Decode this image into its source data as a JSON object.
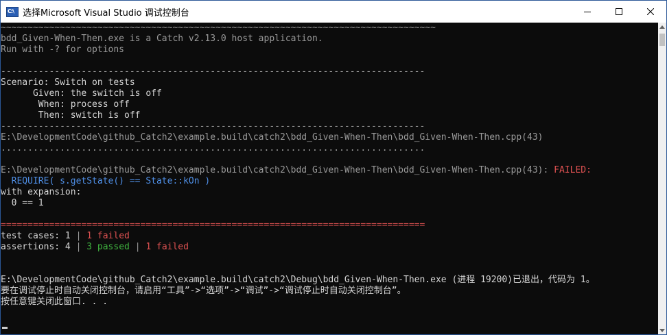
{
  "window": {
    "title": "选择Microsoft Visual Studio 调试控制台",
    "icon_label": "C:\\"
  },
  "console": {
    "lines": [
      {
        "segments": [
          {
            "text": "~~~~~~~~~~~~~~~~~~~~~~~~~~~~~~~~~~~~~~~~~~~~~~~~~~~~~~~~~~~~~~~~~~~~~~~~~~~~~~~~~",
            "style": "gray"
          }
        ]
      },
      {
        "segments": [
          {
            "text": "bdd_Given-When-Then.exe is a Catch v2.13.0 host application.",
            "style": "gray"
          }
        ]
      },
      {
        "segments": [
          {
            "text": "Run with -? for options",
            "style": "gray"
          }
        ]
      },
      {
        "segments": [
          {
            "text": "",
            "style": "gray"
          }
        ]
      },
      {
        "segments": [
          {
            "text": "-------------------------------------------------------------------------------",
            "style": "gray"
          }
        ]
      },
      {
        "segments": [
          {
            "text": "Scenario: Switch on tests",
            "style": "white"
          }
        ]
      },
      {
        "segments": [
          {
            "text": "      Given: the switch is off",
            "style": "white"
          }
        ]
      },
      {
        "segments": [
          {
            "text": "       When: process off",
            "style": "white"
          }
        ]
      },
      {
        "segments": [
          {
            "text": "       Then: switch is off",
            "style": "white"
          }
        ]
      },
      {
        "segments": [
          {
            "text": "-------------------------------------------------------------------------------",
            "style": "gray"
          }
        ]
      },
      {
        "segments": [
          {
            "text": "E:\\DevelopmentCode\\github_Catch2\\example.build\\catch2\\bdd_Given-When-Then\\bdd_Given-When-Then.cpp(43)",
            "style": "gray"
          }
        ]
      },
      {
        "segments": [
          {
            "text": "...............................................................................",
            "style": "gray"
          }
        ]
      },
      {
        "segments": [
          {
            "text": "",
            "style": "gray"
          }
        ]
      },
      {
        "segments": [
          {
            "text": "E:\\DevelopmentCode\\github_Catch2\\example.build\\catch2\\bdd_Given-When-Then\\bdd_Given-When-Then.cpp(43): ",
            "style": "gray"
          },
          {
            "text": "FAILED:",
            "style": "red"
          }
        ]
      },
      {
        "segments": [
          {
            "text": "  REQUIRE( s.getState() == State::kOn )",
            "style": "blue"
          }
        ]
      },
      {
        "segments": [
          {
            "text": "with expansion:",
            "style": "white"
          }
        ]
      },
      {
        "segments": [
          {
            "text": "  0 == 1",
            "style": "white"
          }
        ]
      },
      {
        "segments": [
          {
            "text": "",
            "style": "gray"
          }
        ]
      },
      {
        "segments": [
          {
            "text": "===============================================================================",
            "style": "red"
          }
        ]
      },
      {
        "segments": [
          {
            "text": "test cases: 1 ",
            "style": "white"
          },
          {
            "text": "|",
            "style": "gray"
          },
          {
            "text": " 1 failed",
            "style": "red"
          }
        ]
      },
      {
        "segments": [
          {
            "text": "assertions: 4 ",
            "style": "white"
          },
          {
            "text": "|",
            "style": "gray"
          },
          {
            "text": " 3 passed ",
            "style": "green"
          },
          {
            "text": "|",
            "style": "gray"
          },
          {
            "text": " 1 failed",
            "style": "red"
          }
        ]
      },
      {
        "segments": [
          {
            "text": "",
            "style": "gray"
          }
        ]
      },
      {
        "segments": [
          {
            "text": "",
            "style": "gray"
          }
        ]
      },
      {
        "segments": [
          {
            "text": "E:\\DevelopmentCode\\github_Catch2\\example.build\\catch2\\Debug\\bdd_Given-When-Then.exe (进程 19200)已退出，代码为 1。",
            "style": "white cjk-mixed"
          }
        ]
      },
      {
        "segments": [
          {
            "text": "要在调试停止时自动关闭控制台，请启用“工具”->“选项”->“调试”->“调试停止时自动关闭控制台”。",
            "style": "white cjk-mixed"
          }
        ]
      },
      {
        "segments": [
          {
            "text": "按任意键关闭此窗口. . .",
            "style": "white cjk-mixed"
          }
        ]
      }
    ]
  }
}
